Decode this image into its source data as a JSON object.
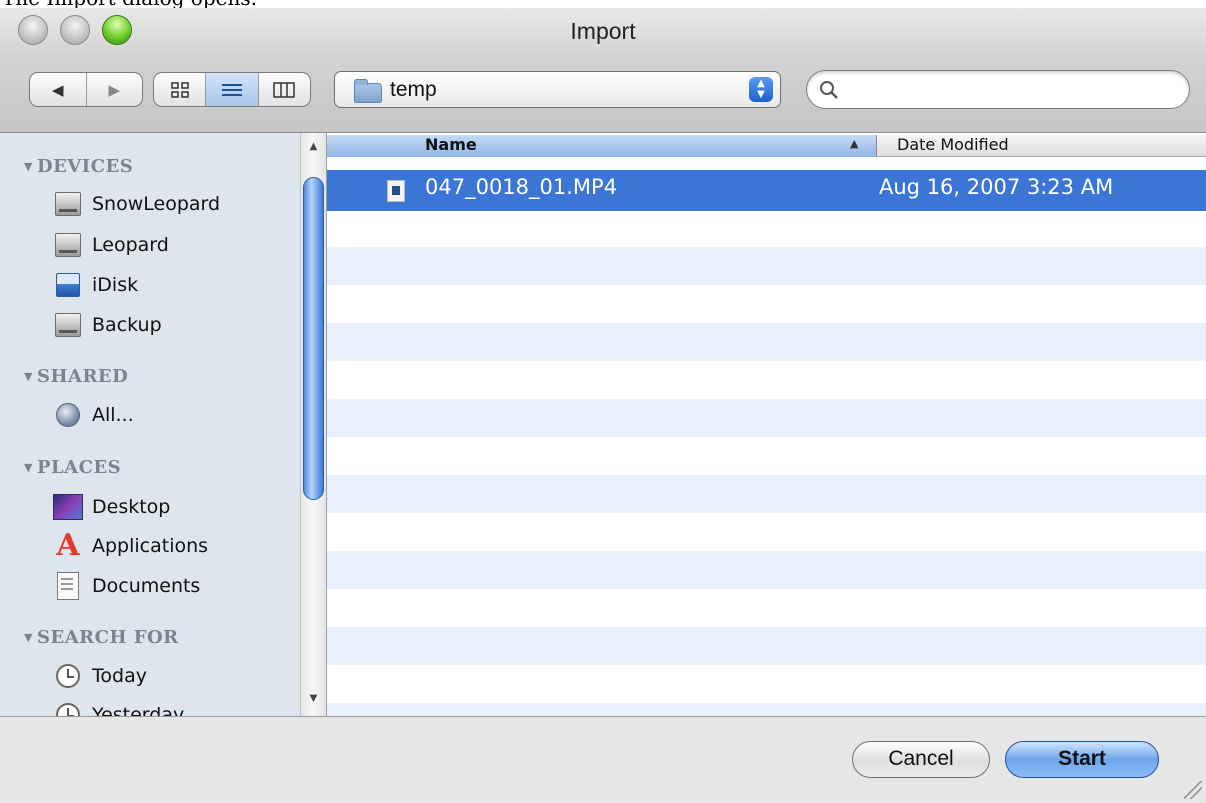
{
  "page_caption": "The Import dialog opens.",
  "window": {
    "title": "Import"
  },
  "toolbar": {
    "back_icon": "back-arrow-icon",
    "forward_icon": "forward-arrow-icon",
    "view_modes": [
      "icon-view-icon",
      "list-view-icon",
      "column-view-icon"
    ],
    "active_view": "list-view-icon",
    "location": "temp",
    "search": {
      "value": "",
      "placeholder": ""
    }
  },
  "sidebar": {
    "sections": [
      {
        "title": "DEVICES",
        "items": [
          {
            "label": "SnowLeopard",
            "icon": "hard-drive-icon"
          },
          {
            "label": "Leopard",
            "icon": "hard-drive-icon"
          },
          {
            "label": "iDisk",
            "icon": "idisk-icon"
          },
          {
            "label": "Backup",
            "icon": "hard-drive-icon"
          }
        ]
      },
      {
        "title": "SHARED",
        "items": [
          {
            "label": "All...",
            "icon": "network-globe-icon"
          }
        ]
      },
      {
        "title": "PLACES",
        "items": [
          {
            "label": "Desktop",
            "icon": "desktop-icon"
          },
          {
            "label": "Applications",
            "icon": "applications-icon"
          },
          {
            "label": "Documents",
            "icon": "documents-icon"
          }
        ]
      },
      {
        "title": "SEARCH FOR",
        "items": [
          {
            "label": "Today",
            "icon": "clock-icon"
          },
          {
            "label": "Yesterday",
            "icon": "clock-icon"
          }
        ]
      }
    ]
  },
  "file_list": {
    "columns": [
      "Name",
      "Date Modified"
    ],
    "sort_column": "Name",
    "sort_direction": "ascending",
    "rows": [
      {
        "name": "047_0018_01.MP4",
        "date_modified": "Aug 16, 2007 3:23 AM",
        "selected": true,
        "icon": "movie-file-icon"
      }
    ]
  },
  "footer": {
    "cancel_label": "Cancel",
    "start_label": "Start"
  },
  "colors": {
    "selection": "#3b76d6",
    "sidebar_bg": "#dfe5ed",
    "stripe": "#e9f0fb",
    "default_button": "#6ea6ec"
  }
}
